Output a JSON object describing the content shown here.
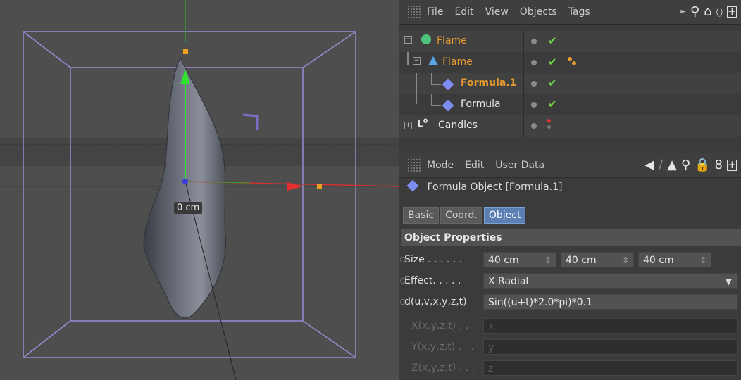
{
  "viewport": {
    "distance_label": "0 cm"
  },
  "object_manager": {
    "menu": [
      "File",
      "Edit",
      "View",
      "Objects",
      "Tags"
    ],
    "objects": [
      {
        "name": "Flame",
        "color": "#e59a2e",
        "bold": false
      },
      {
        "name": "Flame",
        "color": "#e59a2e",
        "bold": false
      },
      {
        "name": "Formula.1",
        "color": "#e59a2e",
        "bold": true
      },
      {
        "name": "Formula",
        "color": "#e8e8e8",
        "bold": false
      },
      {
        "name": "Candles",
        "color": "#e8e8e8",
        "bold": false
      }
    ]
  },
  "attribute_manager": {
    "menu": [
      "Mode",
      "Edit",
      "User Data"
    ],
    "object_title": "Formula Object [Formula.1]",
    "tabs": [
      "Basic",
      "Coord.",
      "Object"
    ],
    "active_tab": "Object",
    "section": "Object Properties",
    "size": {
      "label": "Size . . . . . .",
      "x": "40 cm",
      "y": "40 cm",
      "z": "40 cm"
    },
    "effect": {
      "label": "Effect. . . . .",
      "value": "X Radial"
    },
    "d": {
      "label": "d(u,v,x,y,z,t)",
      "value": "Sin((u+t)*2.0*pi)*0.1"
    },
    "x": {
      "label": "X(x,y,z,t) . . .",
      "value": "x"
    },
    "y": {
      "label": "Y(x,y,z,t) . . .",
      "value": "y"
    },
    "z": {
      "label": "Z(x,y,z,t) . . .",
      "value": "z"
    }
  },
  "colors": {
    "accent": "#e59a2e",
    "selected_tab": "#5b7fb2",
    "check": "#6fd34a"
  }
}
